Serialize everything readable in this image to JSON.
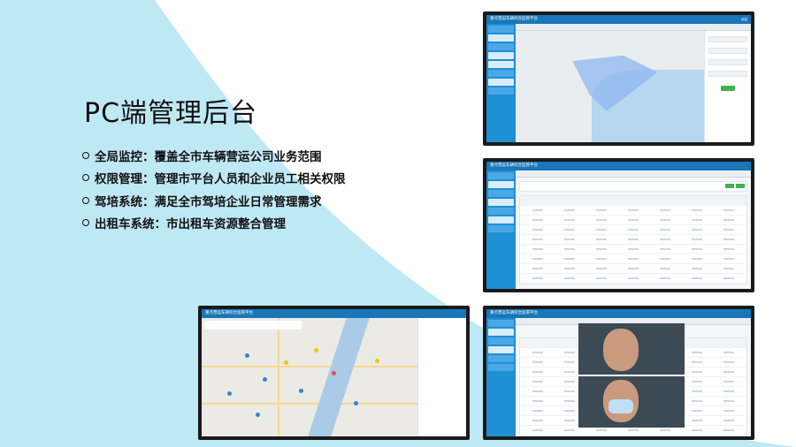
{
  "title": "PC端管理后台",
  "features": [
    "全局监控：覆盖全市车辆营运公司业务范围",
    "权限管理：管理市平台人员和企业员工相关权限",
    "驾培系统：满足全市驾培企业日常管理需求",
    "出租车系统：市出租车资源整合管理"
  ],
  "screens": [
    {
      "app_title": "重点营运车辆综合监管平台",
      "user": "欢迎",
      "confirm": "确定"
    },
    {
      "app_title": "重点营运车辆综合监管平台"
    },
    {
      "app_title": "重点营运车辆综合监管平台"
    },
    {
      "app_title": "重点营运车辆综合监管平台"
    }
  ],
  "colors": {
    "accent_bg": "#bfe8f5",
    "header": "#1976b8",
    "sidebar": "#1f8fd6",
    "button": "#3fb34f"
  }
}
